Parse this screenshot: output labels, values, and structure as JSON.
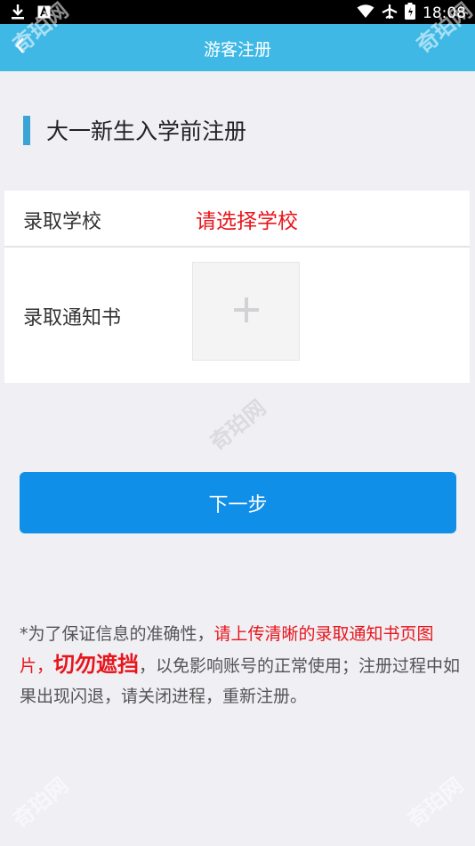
{
  "status_bar": {
    "time": "18:08"
  },
  "nav": {
    "title": "游客注册"
  },
  "section": {
    "title": "大一新生入学前注册"
  },
  "form": {
    "school_label": "录取学校",
    "school_value": "请选择学校",
    "letter_label": "录取通知书"
  },
  "next_button": "下一步",
  "notice": {
    "part1": "*为了保证信息的准确性，",
    "part2": "请上传清晰的录取通知书页图片，",
    "part3": "切勿遮挡",
    "part4": "，以免影响账号的正常使用；注册过程中如果出现闪退，请关闭进程，重新注册。"
  },
  "watermark": "奇珀网",
  "colors": {
    "nav": "#3fb8e6",
    "button": "#108fe9",
    "alert": "#e8151b",
    "accent_bar": "#3aa5d4"
  }
}
